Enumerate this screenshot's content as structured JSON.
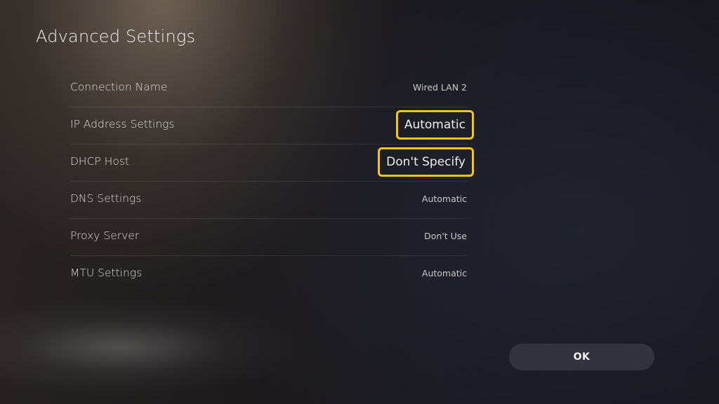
{
  "page": {
    "title": "Advanced Settings"
  },
  "settings": [
    {
      "label": "Connection Name",
      "value": "Wired LAN 2",
      "highlighted": false
    },
    {
      "label": "IP Address Settings",
      "value": "Automatic",
      "highlighted": true
    },
    {
      "label": "DHCP Host",
      "value": "Don't Specify",
      "highlighted": true
    },
    {
      "label": "DNS Settings",
      "value": "Automatic",
      "highlighted": false
    },
    {
      "label": "Proxy Server",
      "value": "Don't Use",
      "highlighted": false
    },
    {
      "label": "MTU Settings",
      "value": "Automatic",
      "highlighted": false
    }
  ],
  "actions": {
    "ok_label": "OK"
  },
  "colors": {
    "highlight_border": "#f5c518"
  }
}
